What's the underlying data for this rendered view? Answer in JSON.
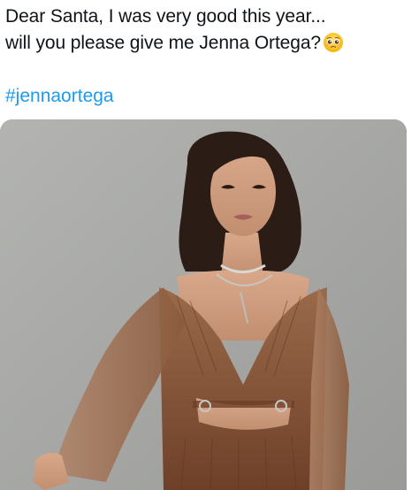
{
  "post": {
    "text_line1": "Dear Santa, I was very good this year...",
    "text_line2": "will you please give me Jenna Ortega?",
    "emoji": "pleading-face-emoji",
    "hashtag": "#jennaortega"
  },
  "media": {
    "type": "photo",
    "background_color": "#a8a9a6",
    "dress_color": "#8a5a3c"
  },
  "colors": {
    "text": "#0f1419",
    "link": "#1d9bf0"
  }
}
